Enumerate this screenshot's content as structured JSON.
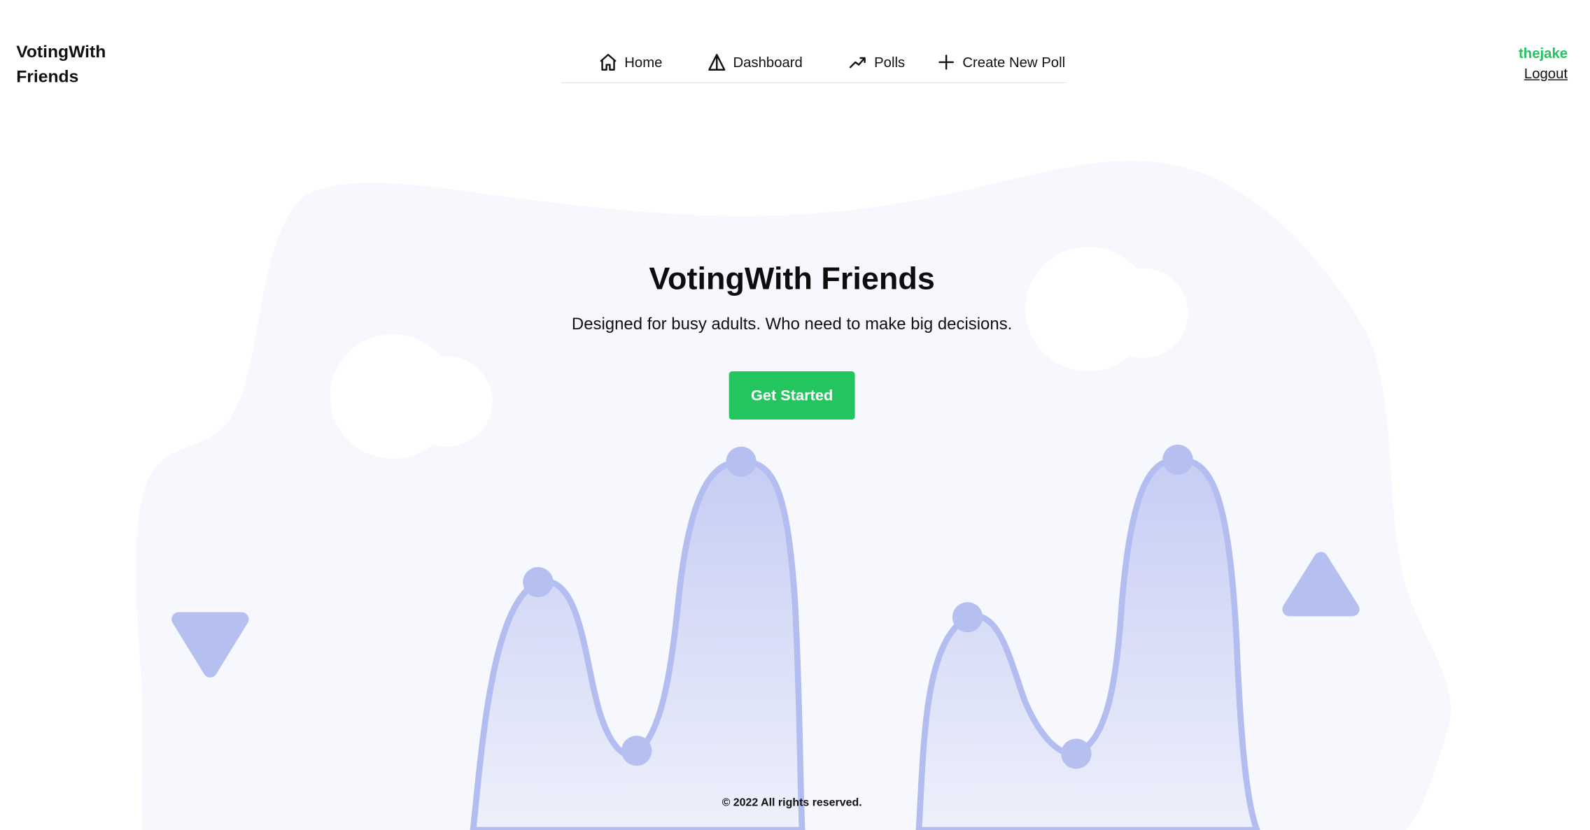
{
  "app": {
    "brand": "VotingWith Friends"
  },
  "nav": {
    "items": [
      {
        "label": "Home",
        "icon": "home-icon"
      },
      {
        "label": "Dashboard",
        "icon": "dashboard-icon"
      },
      {
        "label": "Polls",
        "icon": "trending-up-icon"
      },
      {
        "label": "Create New Poll",
        "icon": "plus-icon"
      }
    ]
  },
  "user": {
    "username": "thejake",
    "logout_label": "Logout"
  },
  "hero": {
    "title": "VotingWith Friends",
    "subtitle": "Designed for busy adults. Who need to make big decisions.",
    "cta_label": "Get Started"
  },
  "footer": {
    "copyright": "© 2022 All rights reserved."
  },
  "colors": {
    "accent": "#22c55e",
    "illustration_fill": "#c5cdf3",
    "illustration_stroke": "#b3bdf0",
    "blob": "#f7f8fd"
  }
}
